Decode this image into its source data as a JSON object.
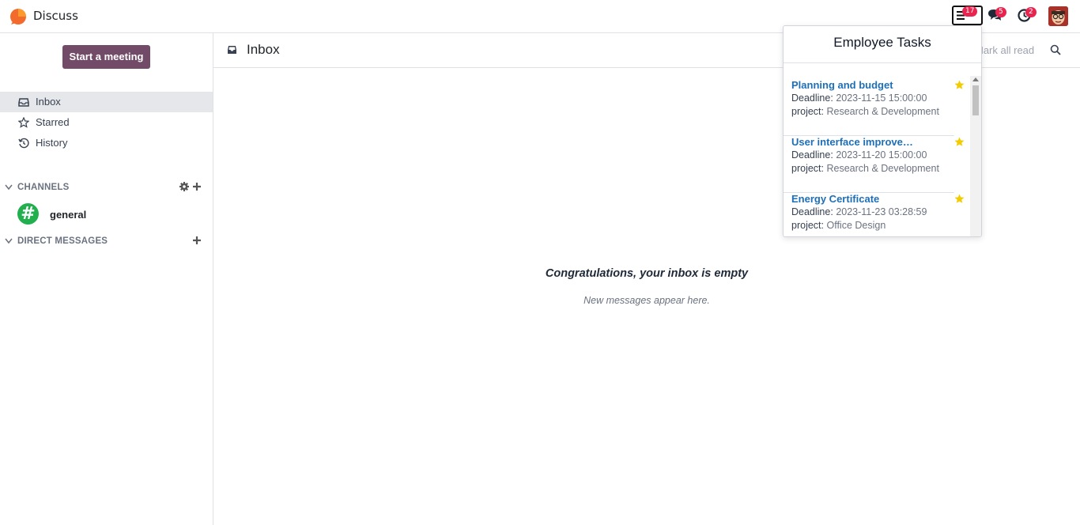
{
  "app": {
    "name": "Discuss"
  },
  "systray": {
    "tasks_badge": "17",
    "messages_badge": "5",
    "activity_badge": "2"
  },
  "sidebar": {
    "meeting_button": "Start a meeting",
    "items": [
      {
        "label": "Inbox",
        "icon": "inbox-icon",
        "active": true
      },
      {
        "label": "Starred",
        "icon": "star-icon"
      },
      {
        "label": "History",
        "icon": "history-icon"
      }
    ],
    "channels_label": "CHANNELS",
    "channels": [
      {
        "label": "general"
      }
    ],
    "dm_label": "DIRECT MESSAGES"
  },
  "main": {
    "title": "Inbox",
    "mark_all_read": "Mark all read",
    "empty_title": "Congratulations, your inbox is empty",
    "empty_sub": "New messages appear here."
  },
  "dropdown": {
    "title": "Employee Tasks",
    "deadline_label": "Deadline:",
    "project_label": "project:",
    "tasks": [
      {
        "name": "Planning and budget",
        "deadline": "2023-11-15 15:00:00",
        "project": "Research & Development"
      },
      {
        "name": "User interface improve…",
        "deadline": "2023-11-20 15:00:00",
        "project": "Research & Development"
      },
      {
        "name": "Energy Certificate",
        "deadline": "2023-11-23 03:28:59",
        "project": "Office Design"
      }
    ]
  },
  "colors": {
    "brand": "#714b67",
    "badge": "#e8254e",
    "link": "#1d6fb8",
    "star": "#f3cc00",
    "channel": "#22b04f"
  }
}
